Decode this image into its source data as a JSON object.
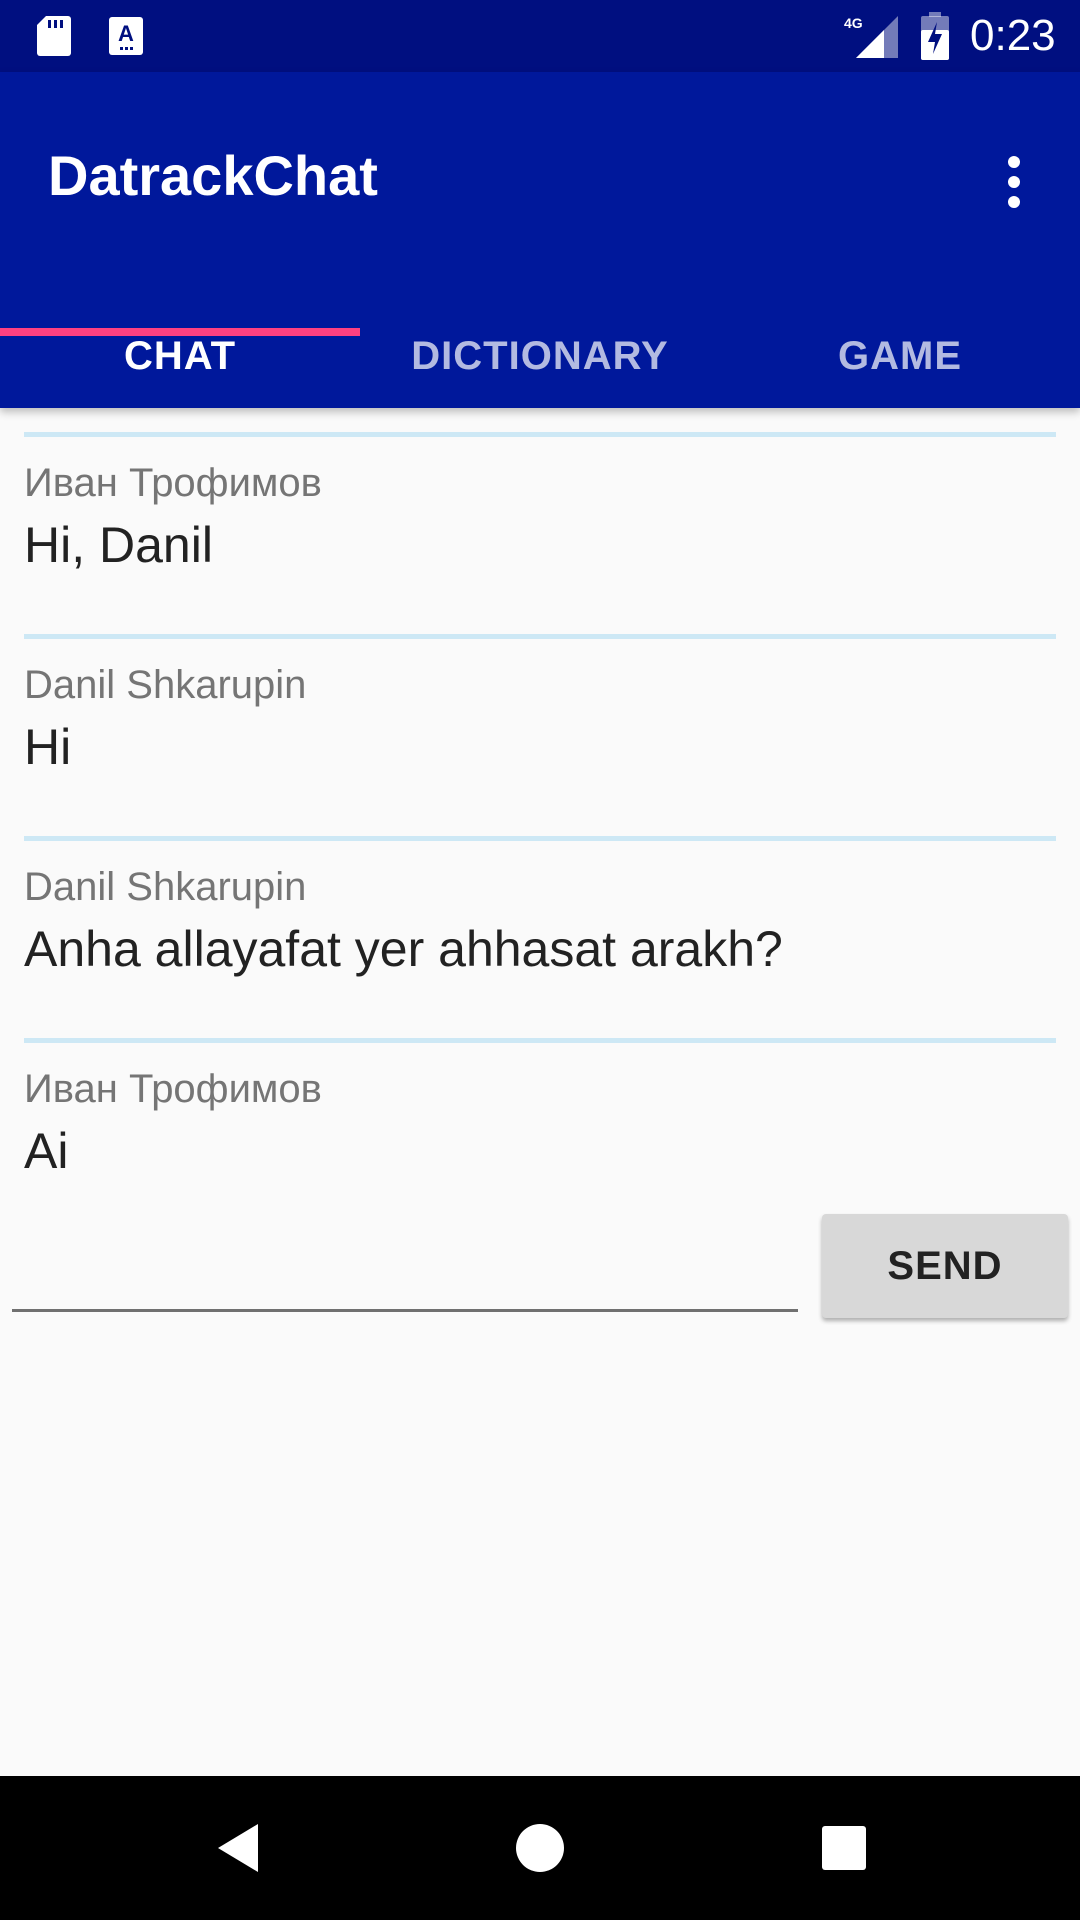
{
  "status_bar": {
    "time": "0:23",
    "network": "4G",
    "icons": [
      "sd-card-icon",
      "keyboard-a-icon",
      "signal-icon",
      "battery-charging-icon"
    ]
  },
  "app_bar": {
    "title": "DatrackChat",
    "menu_icon": "overflow-menu-icon",
    "background": "#00189b",
    "status_background": "#000f80"
  },
  "tabs": {
    "items": [
      {
        "label": "CHAT",
        "active": true
      },
      {
        "label": "DICTIONARY",
        "active": false
      },
      {
        "label": "GAME",
        "active": false
      }
    ],
    "indicator_color": "#ff4081"
  },
  "messages": [
    {
      "author": "Иван Трофимов",
      "text": "Hi, Danil"
    },
    {
      "author": "Danil Shkarupin",
      "text": "Hi"
    },
    {
      "author": "Danil Shkarupin",
      "text": "Anha allayafat yer ahhasat arakh?"
    },
    {
      "author": "Иван Трофимов",
      "text": "Ai"
    }
  ],
  "composer": {
    "input_value": "",
    "send_label": "SEND"
  },
  "nav_bar": {
    "icons": [
      "back-icon",
      "home-icon",
      "recents-icon"
    ]
  }
}
